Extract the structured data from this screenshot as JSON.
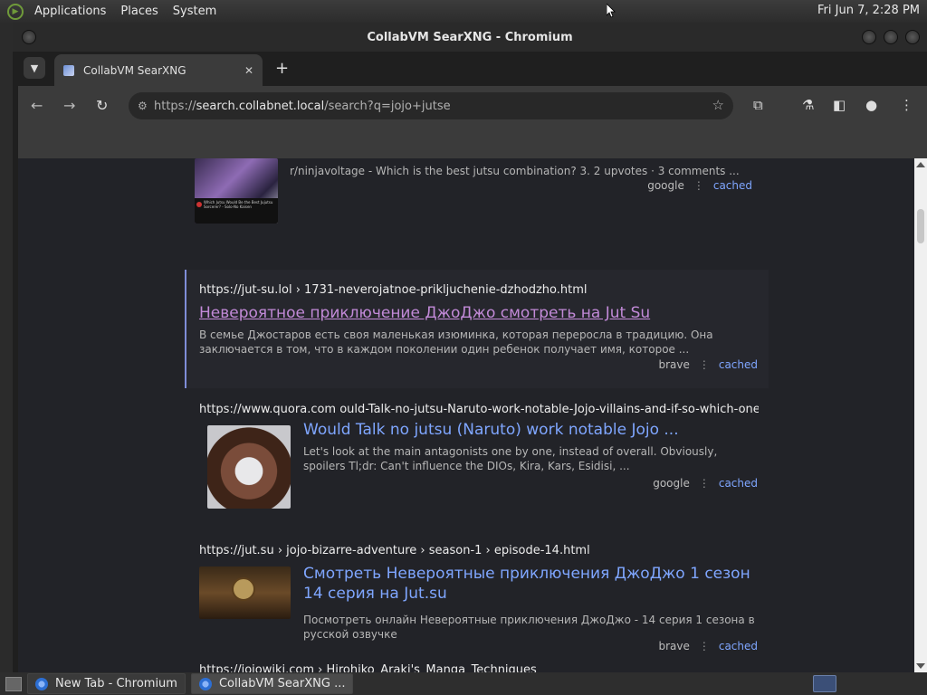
{
  "panel": {
    "menus": [
      "Applications",
      "Places",
      "System"
    ],
    "clock": "Fri Jun  7,  2:28 PM"
  },
  "window": {
    "title": "CollabVM SearXNG - Chromium"
  },
  "tab": {
    "label": "CollabVM SearXNG",
    "close": "✕",
    "new_tab": "+"
  },
  "toolbar": {
    "url_scheme": "https://",
    "url_host": "search.collabnet.local",
    "url_path": "/search?q=jojo+jutse"
  },
  "results": [
    {
      "url": "",
      "title": "",
      "snippet": "r/ninjavoltage - Which is the best jutsu combination? 3. 2 upvotes · 3 comments ...",
      "engine": "google",
      "cached": "cached"
    },
    {
      "url": "https://jut-su.lol  › 1731-neverojatnoe-prikljuchenie-dzhodzho.html",
      "title": "Невероятное приключение ДжоДжо смотреть на Jut Su",
      "snippet": "В семье Джостаров есть своя маленькая изюминка, которая переросла в традицию. Она заключается в том, что в каждом поколении один ребенок получает имя, которое ...",
      "engine": "brave",
      "cached": "cached"
    },
    {
      "url": "https://www.quora.com ould-Talk-no-jutsu-Naruto-work-notable-Jojo-villains-and-if-so-which-ones",
      "title": "Would Talk no jutsu (Naruto) work notable Jojo ...",
      "snippet": "Let's look at the main antagonists one by one, instead of overall. Obviously, spoilers Tl;dr: Can't influence the DIOs, Kira, Kars, Esidisi, ...",
      "engine": "google",
      "cached": "cached"
    },
    {
      "url": "https://jut.su  › jojo-bizarre-adventure › season-1 › episode-14.html",
      "title": "Смотреть Невероятные приключения ДжоДжо 1 сезон 14 серия на Jut.su",
      "snippet": "Посмотреть онлайн Невероятные приключения ДжоДжо - 14 серия 1 сезона в русской озвучке",
      "engine": "brave",
      "cached": "cached"
    },
    {
      "url": "https://jojowiki.com  › Hirohiko_Araki's_Manga_Techniques",
      "title": "",
      "snippet": "",
      "engine": "",
      "cached": ""
    }
  ],
  "thumb_caption": "Which Jutsu Would Be the Best Jujutsu Sorcerer? - Solo-No Kaisen",
  "taskbar": {
    "tasks": [
      "New Tab - Chromium",
      "CollabVM SearXNG ..."
    ]
  },
  "colors": {
    "link": "#7fa6ff",
    "visited": "#c28ad8",
    "page_bg": "#222328"
  }
}
